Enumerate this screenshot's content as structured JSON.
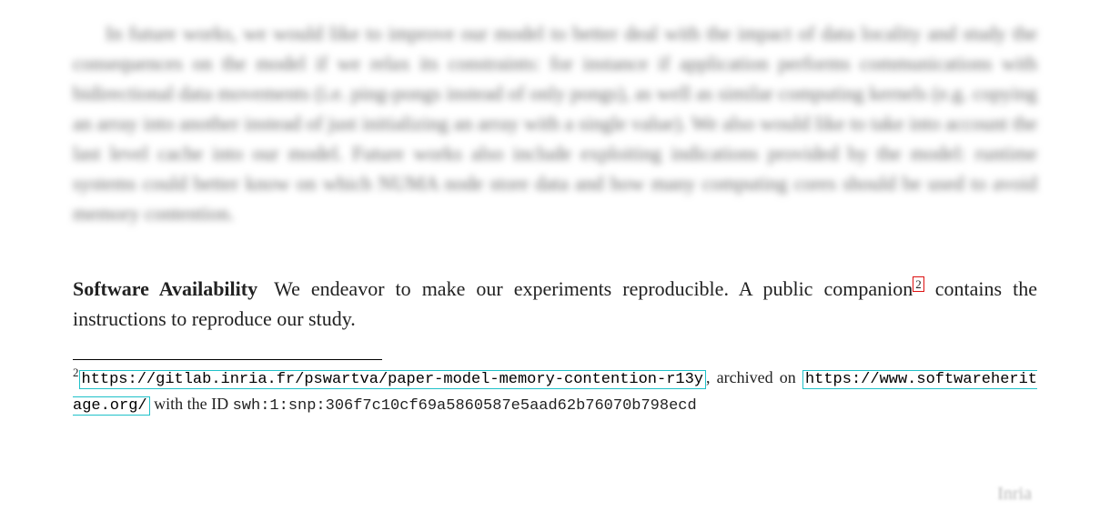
{
  "blurred_paragraph": "In future works, we would like to improve our model to better deal with the impact of data locality and study the consequences on the model if we relax its constraints: for instance if application performs communications with bidirectional data movements (i.e. ping-pongs instead of only pongs), as well as similar computing kernels (e.g. copying an array into another instead of just initializing an array with a single value). We also would like to take into account the last level cache into our model. Future works also include exploiting indications provided by the model: runtime systems could better know on which NUMA node store data and how many computing cores should be used to avoid memory contention.",
  "section": {
    "heading": "Software Availability",
    "body_before_ref": "We endeavor to make our experiments reproducible. A public companion",
    "ref_number": "2",
    "body_after_ref": " contains the instructions to reproduce our study."
  },
  "footnote": {
    "number": "2",
    "url1": "https://gitlab.inria.fr/pswartva/paper-model-memory-contention-r13y",
    "middle": ", archived on ",
    "url2": "https://www.softwareheritage.org/",
    "tail_prefix": " with the ID ",
    "swhid": "swh:1:snp:306f7c10cf69a5860587e5aad62b76070b798ecd"
  },
  "publisher": "Inria"
}
